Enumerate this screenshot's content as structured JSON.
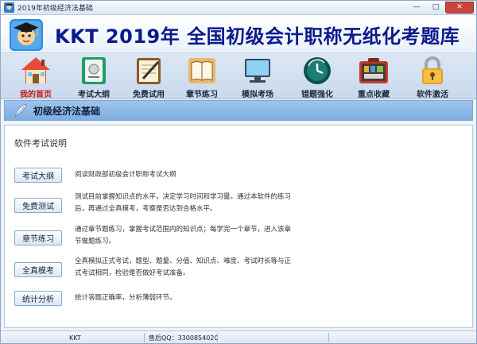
{
  "window": {
    "title": "2019年初级经济法基础"
  },
  "window_controls": {
    "minimize": "—",
    "maximize": "□",
    "close": "✕"
  },
  "banner": {
    "title": "KKT 2019年 全国初级会计职称无纸化考题库"
  },
  "toolbar": {
    "items": [
      {
        "label": "我的首页",
        "icon": "house-icon"
      },
      {
        "label": "考试大纲",
        "icon": "outline-book-icon"
      },
      {
        "label": "免费试用",
        "icon": "notebook-pen-icon"
      },
      {
        "label": "章节练习",
        "icon": "open-book-icon"
      },
      {
        "label": "模拟考场",
        "icon": "monitor-icon"
      },
      {
        "label": "错题强化",
        "icon": "clock-arrow-icon"
      },
      {
        "label": "重点收藏",
        "icon": "toolbox-icon"
      },
      {
        "label": "软件激活",
        "icon": "padlock-icon"
      }
    ],
    "active_index": 0
  },
  "section": {
    "title": "初级经济法基础"
  },
  "content": {
    "title": "软件考试说明",
    "rows": [
      {
        "button": "考试大纲",
        "desc": "阅读财政部初级会计职称考试大纲"
      },
      {
        "button": "免费测试",
        "desc": "测试目前掌握知识点的水平，决定学习时间和学习量。通过本软件的练习后，再通过全真模考，考察是否达到合格水平。"
      },
      {
        "button": "章节练习",
        "desc": "通过章节题练习，掌握考试范围内的知识点；每学完一个章节，进入该章节做题练习。"
      },
      {
        "button": "全真模考",
        "desc": "全真模拟正式考试，题型、题量、分值、知识点、难度、考试时长等与正式考试相同，检验是否做好考试准备。"
      },
      {
        "button": "统计分析",
        "desc": "统计答题正确率，分析薄弱环节。"
      }
    ]
  },
  "status": {
    "left": "KKT",
    "mid": "售后QQ：3300854020"
  },
  "colors": {
    "banner_text": "#0b1a8c",
    "active_label": "#c71818",
    "section_bg": "#8db8e8"
  }
}
